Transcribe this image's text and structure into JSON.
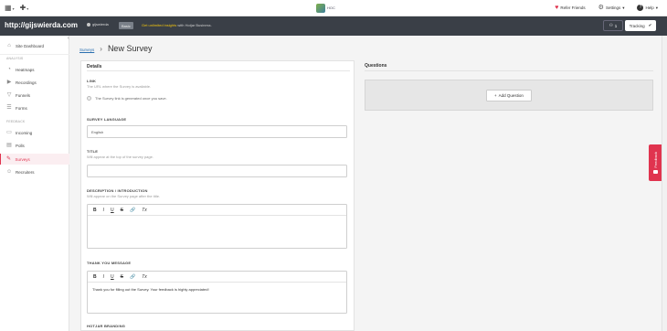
{
  "topbar": {
    "grid_icon": "grid-icon",
    "add_icon": "plus-icon",
    "logo_text": "HOC",
    "refer_label": "Refer Friends",
    "settings_label": "Settings",
    "help_label": "Help"
  },
  "sitebar": {
    "url": "http://gijswierda.com",
    "site_chip": "gijswierda",
    "plan": "Basic",
    "upgrade_prefix": "Get unlimited insights",
    "upgrade_suffix": " with Hotjar Business.",
    "user_count": "1",
    "tracking_label": "Tracking",
    "tracking_check": "✔"
  },
  "sidebar": {
    "dashboard": "Site Dashboard",
    "section_analysis": "ANALYSIS",
    "heatmaps": "Heatmaps",
    "recordings": "Recordings",
    "funnels": "Funnels",
    "forms": "Forms",
    "section_feedback": "FEEDBACK",
    "incoming": "Incoming",
    "polls": "Polls",
    "surveys": "Surveys",
    "recruiters": "Recruiters"
  },
  "breadcrumb": {
    "parent": "Surveys",
    "sep": "›",
    "title": "New Survey"
  },
  "details": {
    "title": "Details",
    "link_label": "LINK",
    "link_hint": "The URL where the Survey is available.",
    "link_radio": "The Survey link is generated once you save.",
    "lang_label": "SURVEY LANGUAGE",
    "lang_value": "English",
    "title_label": "TITLE",
    "title_hint": "Will appear at the top of the survey page.",
    "desc_label": "DESCRIPTION / INTRODUCTION",
    "desc_hint": "Will appear on the Survey page after the title.",
    "thanks_label": "THANK YOU MESSAGE",
    "thanks_value": "Thank you for filling out the Survey. Your feedback is highly appreciated!",
    "branding_label": "HOTJAR BRANDING",
    "tb_bold": "B",
    "tb_italic": "I",
    "tb_underline": "U",
    "tb_strike": "S",
    "tb_link": "🔗",
    "tb_clear": "Tx"
  },
  "questions": {
    "title": "Questions",
    "add_label": "Add Question",
    "add_plus": "+"
  },
  "feedback_tab": {
    "label": "Feedback"
  },
  "colors": {
    "accent": "#e0344f",
    "sitebar_bg": "#3a3f47",
    "link": "#2a6fb0"
  }
}
